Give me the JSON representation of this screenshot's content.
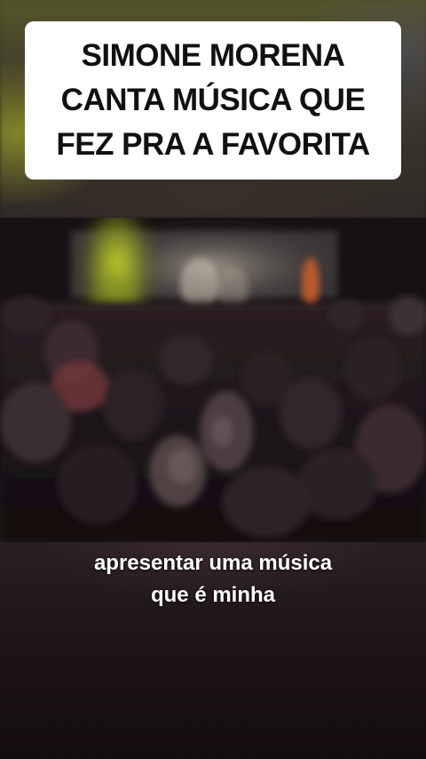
{
  "title_card": {
    "lines": [
      "SIMONE MORENA",
      "CANTA MÚSICA QUE",
      "FEZ PRA A FAVORITA"
    ]
  },
  "caption": {
    "lines": [
      "apresentar uma música",
      "que é minha"
    ]
  },
  "colors": {
    "card_background": "#ffffff",
    "card_text": "#111111",
    "caption_text": "#ffffff",
    "stage_light": "#c8d62a"
  }
}
